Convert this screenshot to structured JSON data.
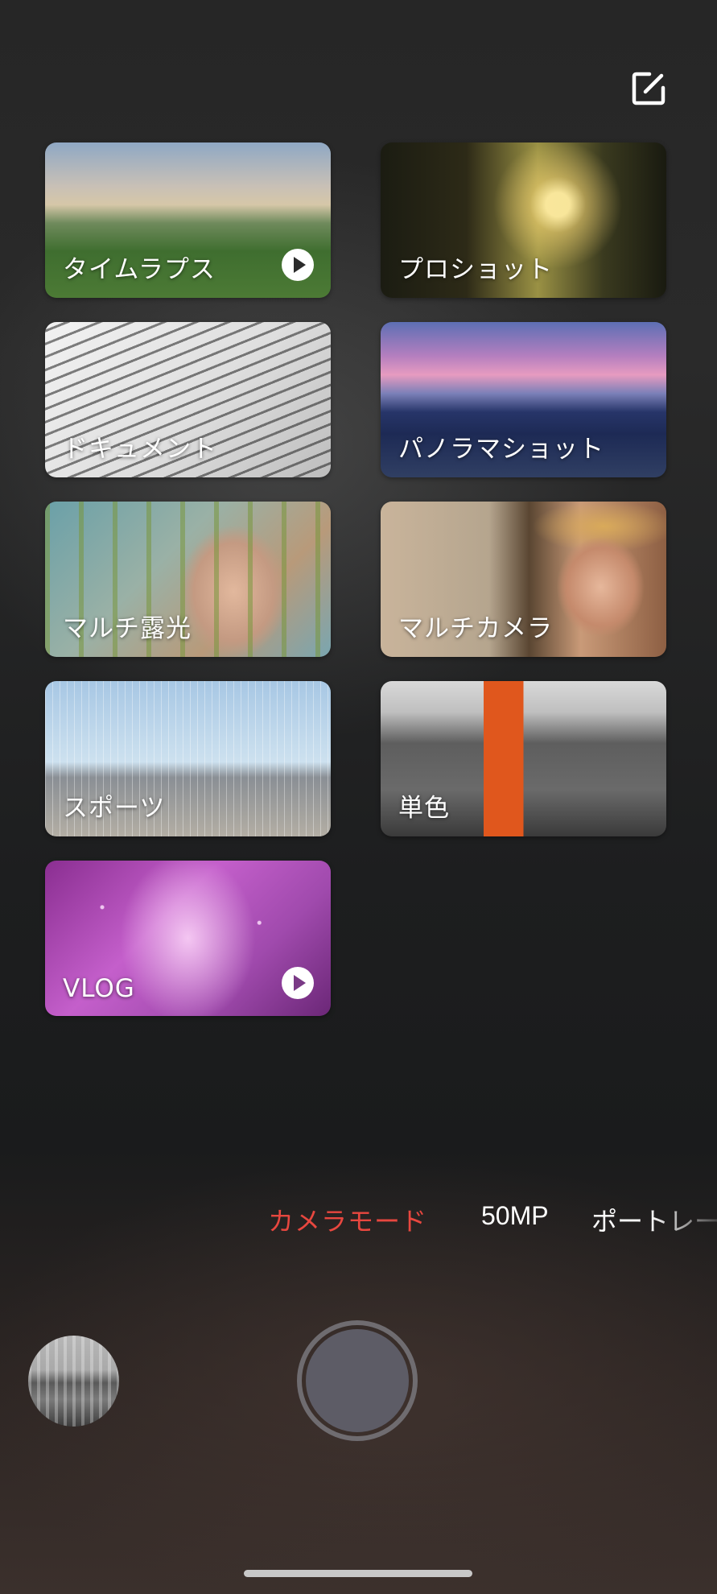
{
  "header": {
    "edit_icon": "edit-square-icon"
  },
  "modes_grid": {
    "tiles": [
      {
        "label": "タイムラプス",
        "has_play_icon": true
      },
      {
        "label": "プロショット",
        "has_play_icon": false
      },
      {
        "label": "ドキュメント",
        "has_play_icon": false
      },
      {
        "label": "パノラマショット",
        "has_play_icon": false
      },
      {
        "label": "マルチ露光",
        "has_play_icon": false
      },
      {
        "label": "マルチカメラ",
        "has_play_icon": false
      },
      {
        "label": "スポーツ",
        "has_play_icon": false
      },
      {
        "label": "単色",
        "has_play_icon": false
      },
      {
        "label": "VLOG",
        "has_play_icon": true
      }
    ]
  },
  "mode_bar": {
    "items": [
      {
        "label": "カメラモード",
        "active": true
      },
      {
        "label": "50MP",
        "active": false
      },
      {
        "label": "ポートレー",
        "active": false
      }
    ],
    "active_color": "#e8473f"
  },
  "controls": {
    "gallery_thumbnail": "gallery-thumbnail",
    "shutter": "shutter-button"
  }
}
